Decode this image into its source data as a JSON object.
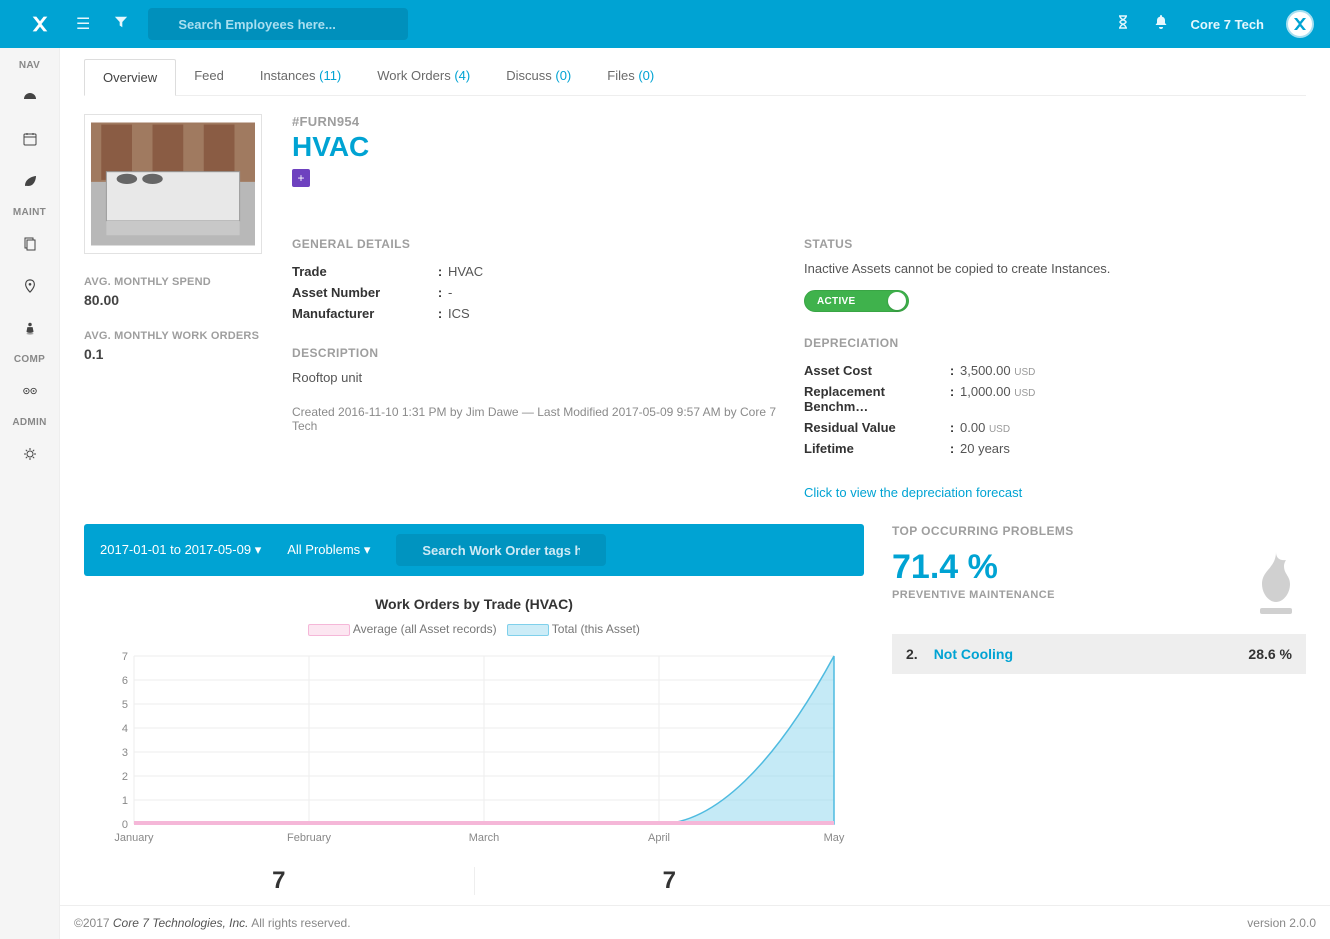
{
  "top": {
    "search_placeholder": "Search Employees here...",
    "username": "Core 7 Tech"
  },
  "leftnav": {
    "groups": [
      "NAV",
      "MAINT",
      "COMP",
      "ADMIN"
    ]
  },
  "tabs": [
    {
      "label": "Overview",
      "count": null
    },
    {
      "label": "Feed",
      "count": null
    },
    {
      "label": "Instances",
      "count": "(11)"
    },
    {
      "label": "Work Orders",
      "count": "(4)"
    },
    {
      "label": "Discuss",
      "count": "(0)"
    },
    {
      "label": "Files",
      "count": "(0)"
    }
  ],
  "asset": {
    "code": "#FURN954",
    "title": "HVAC",
    "avg_monthly_spend_label": "AVG. MONTHLY SPEND",
    "avg_monthly_spend_value": "80.00",
    "avg_monthly_wo_label": "AVG. MONTHLY WORK ORDERS",
    "avg_monthly_wo_value": "0.1"
  },
  "details": {
    "header": "GENERAL DETAILS",
    "trade_label": "Trade",
    "trade_value": "HVAC",
    "asset_number_label": "Asset Number",
    "asset_number_value": "-",
    "manufacturer_label": "Manufacturer",
    "manufacturer_value": "ICS",
    "description_header": "DESCRIPTION",
    "description_value": "Rooftop unit",
    "meta": "Created 2016-11-10 1:31 PM by Jim Dawe — Last Modified 2017-05-09 9:57 AM by Core 7 Tech"
  },
  "status": {
    "header": "STATUS",
    "note": "Inactive Assets cannot be copied to create Instances.",
    "toggle_label": "ACTIVE"
  },
  "depreciation": {
    "header": "DEPRECIATION",
    "asset_cost_label": "Asset Cost",
    "asset_cost_value": "3,500.00",
    "asset_cost_currency": "USD",
    "replacement_label": "Replacement Benchm…",
    "replacement_value": "1,000.00",
    "replacement_currency": "USD",
    "residual_label": "Residual Value",
    "residual_value": "0.00",
    "residual_currency": "USD",
    "lifetime_label": "Lifetime",
    "lifetime_value": "20 years",
    "forecast_link": "Click to view the depreciation forecast"
  },
  "chart": {
    "date_range": "2017-01-01 to 2017-05-09",
    "problems_filter": "All Problems",
    "search_placeholder": "Search Work Order tags here...",
    "title": "Work Orders by Trade (HVAC)",
    "legend_avg": "Average (all Asset records)",
    "legend_total": "Total (this Asset)",
    "big_left": "7",
    "big_right": "7"
  },
  "chart_data": {
    "type": "area",
    "title": "Work Orders by Trade (HVAC)",
    "xlabel": "",
    "ylabel": "",
    "ylim": [
      0,
      7
    ],
    "categories": [
      "January",
      "February",
      "March",
      "April",
      "May"
    ],
    "series": [
      {
        "name": "Average (all Asset records)",
        "color": "#f5b7d8",
        "values": [
          0.05,
          0.05,
          0.05,
          0.05,
          0.05
        ]
      },
      {
        "name": "Total (this Asset)",
        "color": "#7fd0eb",
        "values": [
          0,
          0,
          0,
          0,
          7
        ]
      }
    ]
  },
  "problems": {
    "header": "TOP OCCURRING PROBLEMS",
    "pct": "71.4 %",
    "pct_label": "PREVENTIVE MAINTENANCE",
    "rows": [
      {
        "num": "2.",
        "name": "Not Cooling",
        "value": "28.6 %"
      }
    ]
  },
  "footer": {
    "copyright_prefix": "©2017 ",
    "company": "Core 7 Technologies, Inc.",
    "rights": " All rights reserved.",
    "version_label": "version ",
    "version_value": "2.0.0"
  }
}
